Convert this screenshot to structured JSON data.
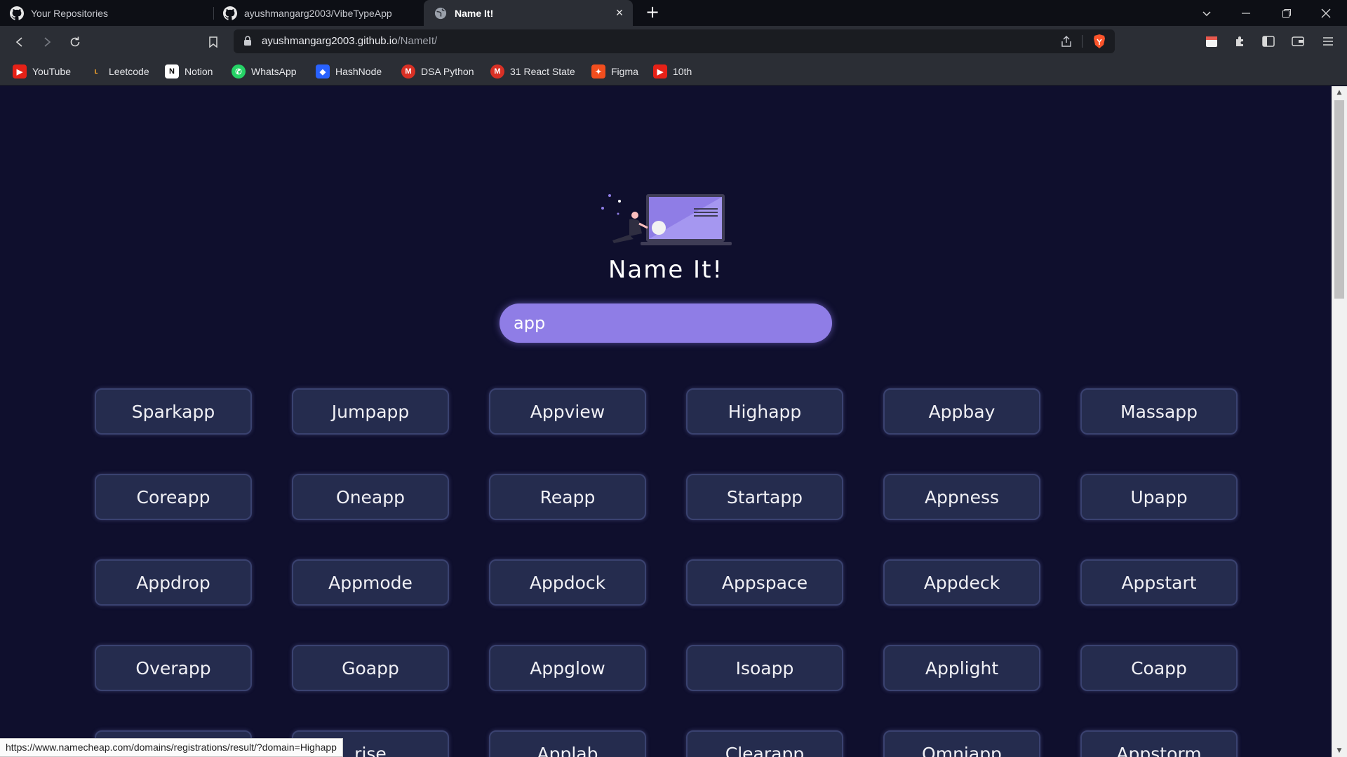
{
  "tabs": [
    {
      "title": "Your Repositories",
      "icon": "github-icon",
      "active": false
    },
    {
      "title": "ayushmangarg2003/VibeTypeApp",
      "icon": "github-icon",
      "active": false
    },
    {
      "title": "Name It!",
      "icon": "globe-icon",
      "active": true
    }
  ],
  "address": {
    "domain": "ayushmangarg2003.github.io",
    "path": "/NameIt/"
  },
  "bookmarks": [
    {
      "label": "YouTube",
      "icon": "youtube-icon",
      "color": "#e62117"
    },
    {
      "label": "Leetcode",
      "icon": "leetcode-icon",
      "color": "#f0a12c"
    },
    {
      "label": "Notion",
      "icon": "notion-icon",
      "color": "#ffffff"
    },
    {
      "label": "WhatsApp",
      "icon": "whatsapp-icon",
      "color": "#25d366"
    },
    {
      "label": "HashNode",
      "icon": "hashnode-icon",
      "color": "#2962ff"
    },
    {
      "label": "DSA Python",
      "icon": "gmail-icon",
      "color": "#d93025"
    },
    {
      "label": "31 React State",
      "icon": "gmail-icon",
      "color": "#d93025"
    },
    {
      "label": "Figma",
      "icon": "figma-icon",
      "color": "#f24e1e"
    },
    {
      "label": "10th",
      "icon": "youtube-icon",
      "color": "#e62117"
    }
  ],
  "app": {
    "title": "Name It!",
    "search_value": "app"
  },
  "names": [
    "Sparkapp",
    "Jumpapp",
    "Appview",
    "Highapp",
    "Appbay",
    "Massapp",
    "Coreapp",
    "Oneapp",
    "Reapp",
    "Startapp",
    "Appness",
    "Upapp",
    "Appdrop",
    "Appmode",
    "Appdock",
    "Appspace",
    "Appdeck",
    "Appstart",
    "Overapp",
    "Goapp",
    "Appglow",
    "Isoapp",
    "Applight",
    "Coapp",
    "",
    "rise",
    "Applab",
    "Clearapp",
    "Omniapp",
    "Appstorm"
  ],
  "status_url": "https://www.namecheap.com/domains/registrations/result/?domain=Highapp",
  "colors": {
    "page_bg": "#0f0f2d",
    "accent": "#8f7de6",
    "button_bg": "#252c4e"
  }
}
